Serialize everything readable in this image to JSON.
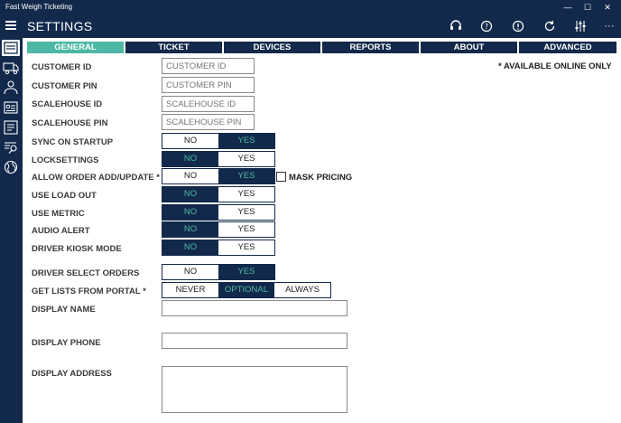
{
  "window": {
    "app_title": "Fast Weigh Ticketing",
    "minimize": "—",
    "maximize": "☐",
    "close": "✕"
  },
  "header": {
    "page_title": "SETTINGS",
    "icons": [
      "headset-icon",
      "help-icon",
      "info-icon",
      "refresh-icon",
      "sliders-icon",
      "more-icon"
    ],
    "more": "···"
  },
  "sidebar": {
    "items": [
      "ticket-list-icon",
      "truck-icon",
      "users-icon",
      "customer-card-icon",
      "reports-icon",
      "search-list-icon",
      "globe-icon"
    ]
  },
  "tabs": [
    "GENERAL",
    "TICKET",
    "DEVICES",
    "REPORTS",
    "ABOUT",
    "ADVANCED"
  ],
  "active_tab": "GENERAL",
  "notice": "* AVAILABLE ONLINE ONLY",
  "fields": {
    "customer_id": {
      "label": "CUSTOMER ID",
      "placeholder": "CUSTOMER ID"
    },
    "customer_pin": {
      "label": "CUSTOMER PIN",
      "placeholder": "CUSTOMER PIN"
    },
    "scalehouse_id": {
      "label": "SCALEHOUSE ID",
      "placeholder": "SCALEHOUSE ID"
    },
    "scalehouse_pin": {
      "label": "SCALEHOUSE PIN",
      "placeholder": "SCALEHOUSE PIN"
    }
  },
  "toggles": {
    "sync_on_startup": {
      "label": "SYNC ON STARTUP",
      "no": "NO",
      "yes": "YES",
      "selected": "YES"
    },
    "locksettings": {
      "label": "LOCKSETTINGS",
      "no": "NO",
      "yes": "YES",
      "selected": "NO"
    },
    "allow_order": {
      "label": "ALLOW ORDER ADD/UPDATE *",
      "no": "NO",
      "yes": "YES",
      "selected": "YES"
    },
    "use_load_out": {
      "label": "USE LOAD OUT",
      "no": "NO",
      "yes": "YES",
      "selected": "NO"
    },
    "use_metric": {
      "label": "USE METRIC",
      "no": "NO",
      "yes": "YES",
      "selected": "NO"
    },
    "audio_alert": {
      "label": "AUDIO ALERT",
      "no": "NO",
      "yes": "YES",
      "selected": "NO"
    },
    "driver_kiosk": {
      "label": "DRIVER KIOSK MODE",
      "no": "NO",
      "yes": "YES",
      "selected": "NO"
    },
    "driver_select": {
      "label": "DRIVER SELECT ORDERS",
      "no": "NO",
      "yes": "YES",
      "selected": "YES"
    }
  },
  "mask_pricing": {
    "label": "MASK PRICING",
    "checked": false
  },
  "lists_from_portal": {
    "label": "GET LISTS FROM PORTAL *",
    "never": "NEVER",
    "optional": "OPTIONAL",
    "always": "ALWAYS",
    "selected": "OPTIONAL"
  },
  "display": {
    "name_label": "DISPLAY NAME",
    "name_value": "",
    "phone_label": "DISPLAY PHONE",
    "phone_value": "",
    "address_label": "DISPLAY ADDRESS",
    "address_value": ""
  },
  "colors": {
    "navy": "#13294b",
    "accent": "#4db8a5"
  }
}
